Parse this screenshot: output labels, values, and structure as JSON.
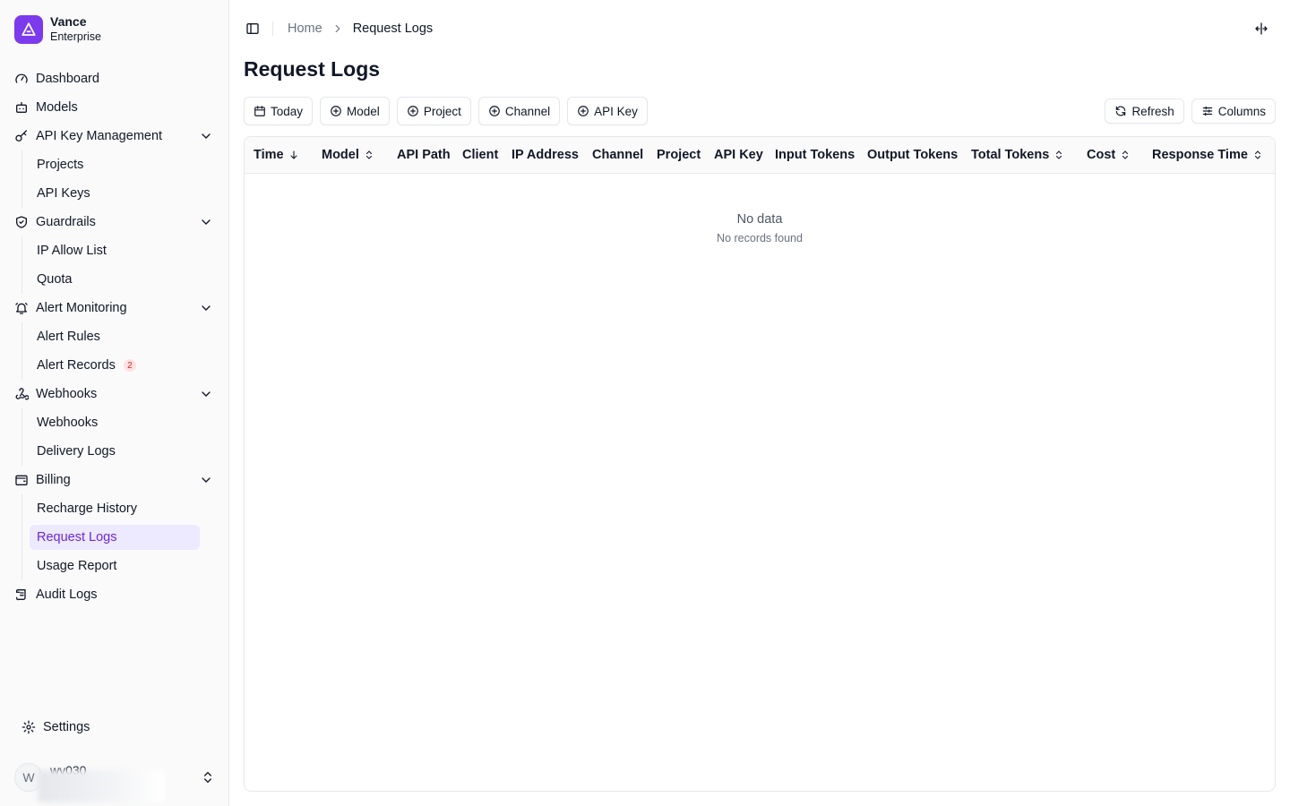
{
  "brand": {
    "name": "Vance",
    "subtitle": "Enterprise",
    "color": "#7c3aed"
  },
  "sidebar": {
    "dashboard": "Dashboard",
    "models": "Models",
    "api_key_management": {
      "label": "API Key Management",
      "items": [
        "Projects",
        "API Keys"
      ]
    },
    "guardrails": {
      "label": "Guardrails",
      "items": [
        "IP Allow List",
        "Quota"
      ]
    },
    "alert_monitoring": {
      "label": "Alert Monitoring",
      "items": [
        "Alert Rules",
        "Alert Records"
      ],
      "alert_records_badge": "2"
    },
    "webhooks": {
      "label": "Webhooks",
      "items": [
        "Webhooks",
        "Delivery Logs"
      ]
    },
    "billing": {
      "label": "Billing",
      "items": [
        "Recharge History",
        "Request Logs",
        "Usage Report"
      ],
      "active": "Request Logs"
    },
    "audit_logs": "Audit Logs",
    "settings": "Settings"
  },
  "user": {
    "initial": "W",
    "name": "wy030"
  },
  "breadcrumb": {
    "home": "Home",
    "current": "Request Logs"
  },
  "page": {
    "title": "Request Logs"
  },
  "filters": {
    "today": "Today",
    "model": "Model",
    "project": "Project",
    "channel": "Channel",
    "api_key": "API Key"
  },
  "actions": {
    "refresh": "Refresh",
    "columns": "Columns"
  },
  "table": {
    "columns": [
      "Time",
      "Model",
      "API Path",
      "Client",
      "IP Address",
      "Channel",
      "Project",
      "API Key",
      "Input Tokens",
      "Output Tokens",
      "Total Tokens",
      "Cost",
      "Response Time"
    ],
    "rows": [],
    "empty_title": "No data",
    "empty_subtitle": "No records found"
  },
  "colors": {
    "accent": "#7c3aed",
    "active_bg": "#ede9fe",
    "badge_bg": "#fee2e2",
    "badge_text": "#dc2626"
  }
}
